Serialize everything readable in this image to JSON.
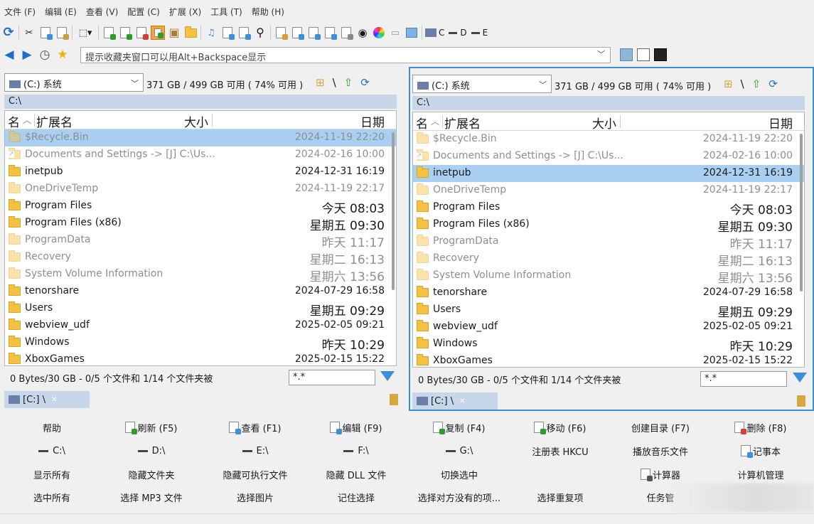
{
  "menu": [
    "文件 (F)",
    "编辑 (E)",
    "查看 (V)",
    "配置 (C)",
    "扩展 (X)",
    "工具 (T)",
    "帮助 (H)"
  ],
  "toolbar": {
    "drives": [
      {
        "label": "C",
        "icon": "drive-c-icon"
      },
      {
        "label": "D",
        "icon": "drive-d-icon"
      },
      {
        "label": "E",
        "icon": "drive-e-icon"
      }
    ]
  },
  "addressbar": {
    "text": "提示收藏夹窗口可以用Alt+Backspace显示"
  },
  "left": {
    "drive": "(C:) 系统",
    "driveinfo": "371 GB / 499 GB 可用 ( 74% 可用 )",
    "path": "C:\\",
    "headers": {
      "name": "名",
      "ext": "扩展名",
      "size": "大小",
      "date": "日期"
    },
    "status": "0 Bytes/30 GB - 0/5 个文件和 1/14 个文件夹被",
    "filter": "*.*",
    "tab": "[C:] \\",
    "rows": [
      {
        "name": "$Recycle.Bin",
        "date": "2024-11-19 22:20",
        "dim": true,
        "selected": true,
        "link": false
      },
      {
        "name": "Documents and Settings ->  [J] C:\\Us...",
        "date": "2024-02-16 10:00",
        "dim": true,
        "selected": false,
        "link": true
      },
      {
        "name": "inetpub",
        "date": "2024-12-31 16:19",
        "dim": false,
        "selected": false,
        "link": false
      },
      {
        "name": "OneDriveTemp",
        "date": "2024-11-19 22:17",
        "dim": true,
        "selected": false,
        "link": false
      },
      {
        "name": "Program Files",
        "date": "今天 08:03",
        "dim": false,
        "selected": false,
        "link": false,
        "big": true
      },
      {
        "name": "Program Files (x86)",
        "date": "星期五 09:30",
        "dim": false,
        "selected": false,
        "link": false,
        "big": true
      },
      {
        "name": "ProgramData",
        "date": "昨天 11:17",
        "dim": true,
        "selected": false,
        "link": false,
        "big": true
      },
      {
        "name": "Recovery",
        "date": "星期二 16:13",
        "dim": true,
        "selected": false,
        "link": false,
        "big": true
      },
      {
        "name": "System Volume Information",
        "date": "星期六 13:56",
        "dim": true,
        "selected": false,
        "link": false,
        "big": true
      },
      {
        "name": "tenorshare",
        "date": "2024-07-29 16:58",
        "dim": false,
        "selected": false,
        "link": false
      },
      {
        "name": "Users",
        "date": "星期五 09:29",
        "dim": false,
        "selected": false,
        "link": false,
        "big": true
      },
      {
        "name": "webview_udf",
        "date": "2025-02-05 09:21",
        "dim": false,
        "selected": false,
        "link": false
      },
      {
        "name": "Windows",
        "date": "昨天 10:29",
        "dim": false,
        "selected": false,
        "link": false,
        "big": true
      },
      {
        "name": "XboxGames",
        "date": "2025-02-15 15:22",
        "dim": false,
        "selected": false,
        "link": false
      }
    ]
  },
  "right": {
    "drive": "(C:) 系统",
    "driveinfo": "371 GB / 499 GB 可用 ( 74% 可用 )",
    "path": "C:\\",
    "headers": {
      "name": "名",
      "ext": "扩展名",
      "size": "大小",
      "date": "日期"
    },
    "status": "0 Bytes/30 GB - 0/5 个文件和 1/14 个文件夹被",
    "filter": "*.*",
    "tab": "[C:] \\",
    "rows": [
      {
        "name": "$Recycle.Bin",
        "date": "2024-11-19 22:20",
        "dim": true,
        "selected": false,
        "link": false
      },
      {
        "name": "Documents and Settings ->  [J] C:\\Us...",
        "date": "2024-02-16 10:00",
        "dim": true,
        "selected": false,
        "link": true
      },
      {
        "name": "inetpub",
        "date": "2024-12-31 16:19",
        "dim": false,
        "selected": true,
        "link": false
      },
      {
        "name": "OneDriveTemp",
        "date": "2024-11-19 22:17",
        "dim": true,
        "selected": false,
        "link": false
      },
      {
        "name": "Program Files",
        "date": "今天 08:03",
        "dim": false,
        "selected": false,
        "link": false,
        "big": true
      },
      {
        "name": "Program Files (x86)",
        "date": "星期五 09:30",
        "dim": false,
        "selected": false,
        "link": false,
        "big": true
      },
      {
        "name": "ProgramData",
        "date": "昨天 11:17",
        "dim": true,
        "selected": false,
        "link": false,
        "big": true
      },
      {
        "name": "Recovery",
        "date": "星期二 16:13",
        "dim": true,
        "selected": false,
        "link": false,
        "big": true
      },
      {
        "name": "System Volume Information",
        "date": "星期六 13:56",
        "dim": true,
        "selected": false,
        "link": false,
        "big": true
      },
      {
        "name": "tenorshare",
        "date": "2024-07-29 16:58",
        "dim": false,
        "selected": false,
        "link": false
      },
      {
        "name": "Users",
        "date": "星期五 09:29",
        "dim": false,
        "selected": false,
        "link": false,
        "big": true
      },
      {
        "name": "webview_udf",
        "date": "2025-02-05 09:21",
        "dim": false,
        "selected": false,
        "link": false
      },
      {
        "name": "Windows",
        "date": "昨天 10:29",
        "dim": false,
        "selected": false,
        "link": false,
        "big": true
      },
      {
        "name": "XboxGames",
        "date": "2025-02-15 15:22",
        "dim": false,
        "selected": false,
        "link": false
      }
    ]
  },
  "buttons": [
    [
      {
        "label": "帮助",
        "icon": ""
      },
      {
        "label": "刷新 (F5)",
        "icon": "refresh-icon",
        "color": "#2d9b2d"
      },
      {
        "label": "查看 (F1)",
        "icon": "view-icon",
        "color": "#3c8fd8"
      },
      {
        "label": "编辑 (F9)",
        "icon": "edit-icon",
        "color": "#3c8fd8"
      },
      {
        "label": "复制 (F4)",
        "icon": "copy-icon",
        "color": "#2d9b2d"
      },
      {
        "label": "移动 (F6)",
        "icon": "move-icon",
        "color": "#2d9b2d"
      },
      {
        "label": "创建目录 (F7)",
        "icon": ""
      },
      {
        "label": "删除 (F8)",
        "icon": "delete-icon",
        "color": "#d83c3c"
      }
    ],
    [
      {
        "label": "C:\\",
        "icon": "drive-icon"
      },
      {
        "label": "D:\\",
        "icon": "drive-icon"
      },
      {
        "label": "E:\\",
        "icon": "drive-icon"
      },
      {
        "label": "F:\\",
        "icon": "drive-icon"
      },
      {
        "label": "G:\\",
        "icon": "drive-icon"
      },
      {
        "label": "注册表 HKCU",
        "icon": ""
      },
      {
        "label": "播放音乐文件",
        "icon": ""
      },
      {
        "label": "记事本",
        "icon": "notepad-icon",
        "color": "#3c8fd8"
      }
    ],
    [
      {
        "label": "显示所有",
        "icon": ""
      },
      {
        "label": "隐藏文件夹",
        "icon": ""
      },
      {
        "label": "隐藏可执行文件",
        "icon": ""
      },
      {
        "label": "隐藏 DLL 文件",
        "icon": ""
      },
      {
        "label": "切换选中",
        "icon": ""
      },
      {
        "label": "",
        "icon": ""
      },
      {
        "label": "计算器",
        "icon": "calculator-icon",
        "color": "#555555"
      },
      {
        "label": "计算机管理",
        "icon": ""
      }
    ],
    [
      {
        "label": "选中所有",
        "icon": ""
      },
      {
        "label": "选择 MP3 文件",
        "icon": ""
      },
      {
        "label": "选择图片",
        "icon": ""
      },
      {
        "label": "记住选择",
        "icon": ""
      },
      {
        "label": "选择对方没有的项...",
        "icon": ""
      },
      {
        "label": "选择重复项",
        "icon": ""
      },
      {
        "label": "任务管",
        "icon": ""
      },
      {
        "label": "",
        "icon": ""
      }
    ]
  ],
  "colors": {
    "accent": "#3c8fd8",
    "selection": "#a9d0f2",
    "pathbar": "#c7d7e9",
    "folder": "#f3c244"
  }
}
